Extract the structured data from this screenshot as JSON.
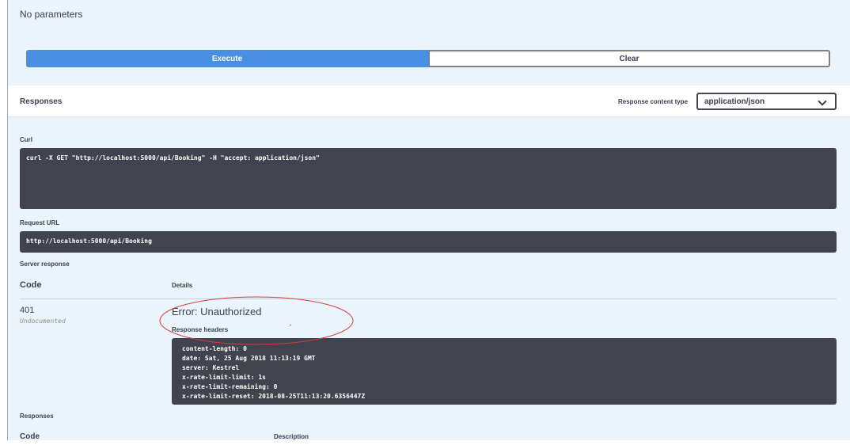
{
  "top": {
    "no_params": "No parameters"
  },
  "buttons": {
    "execute": "Execute",
    "clear": "Clear"
  },
  "responses_header": {
    "title": "Responses",
    "content_type_label": "Response content type",
    "content_type_value": "application/json"
  },
  "curl": {
    "label": "Curl",
    "command": "curl -X GET \"http://localhost:5000/api/Booking\" -H \"accept: application/json\""
  },
  "request_url": {
    "label": "Request URL",
    "value": "http://localhost:5000/api/Booking"
  },
  "server_response": {
    "label": "Server response",
    "col_code": "Code",
    "col_details": "Details",
    "code": "401",
    "code_note": "Undocumented",
    "error": "Error: Unauthorized",
    "headers_label": "Response headers",
    "headers": "content-length: 0\ndate: Sat, 25 Aug 2018 11:13:19 GMT\nserver: Kestrel\nx-rate-limit-limit: 1s\nx-rate-limit-remaining: 0\nx-rate-limit-reset: 2018-08-25T11:13:20.6356447Z"
  },
  "responses_footer": {
    "label": "Responses",
    "col_code": "Code",
    "col_description": "Description"
  },
  "colors": {
    "execute": "#4990e2",
    "code_bg": "#41444e",
    "annotation": "#d04040",
    "panel_bg": "#ebf3fb"
  }
}
